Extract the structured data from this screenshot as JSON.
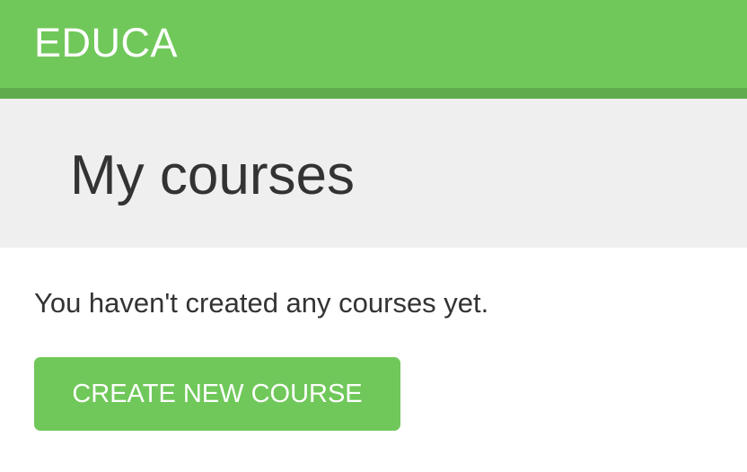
{
  "header": {
    "logo": "EDUCA"
  },
  "title_band": {
    "title": "My courses"
  },
  "content": {
    "empty_message": "You haven't created any courses yet.",
    "create_button_label": "CREATE NEW COURSE"
  },
  "colors": {
    "brand_green": "#70c85a",
    "brand_green_dark": "#5fab4d",
    "title_band_bg": "#efefef",
    "text_dark": "#333333"
  }
}
